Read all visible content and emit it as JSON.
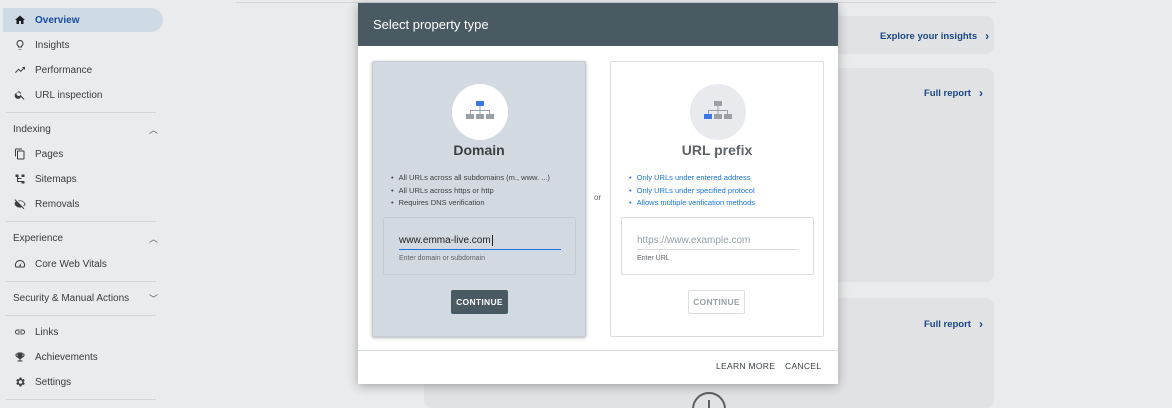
{
  "sidebar": {
    "top_items": [
      {
        "label": "Overview",
        "icon": "home-icon"
      },
      {
        "label": "Insights",
        "icon": "lightbulb-icon"
      },
      {
        "label": "Performance",
        "icon": "trending-up-icon"
      },
      {
        "label": "URL inspection",
        "icon": "search-icon"
      }
    ],
    "indexing": {
      "title": "Indexing",
      "items": [
        {
          "label": "Pages",
          "icon": "pages-icon"
        },
        {
          "label": "Sitemaps",
          "icon": "sitemap-icon"
        },
        {
          "label": "Removals",
          "icon": "eye-off-icon"
        }
      ]
    },
    "experience": {
      "title": "Experience",
      "items": [
        {
          "label": "Core Web Vitals",
          "icon": "speedometer-icon"
        }
      ]
    },
    "security": {
      "title": "Security & Manual Actions"
    },
    "bottom_items": [
      {
        "label": "Links",
        "icon": "link-icon"
      },
      {
        "label": "Achievements",
        "icon": "trophy-icon"
      },
      {
        "label": "Settings",
        "icon": "gear-icon"
      }
    ]
  },
  "background": {
    "explore_link": "Explore your insights",
    "full_report_1": "Full report",
    "full_report_2": "Full report"
  },
  "dialog": {
    "title": "Select property type",
    "or_label": "or",
    "domain": {
      "title": "Domain",
      "bullets": [
        "All URLs across all subdomains (m., www. ...)",
        "All URLs across https or http",
        "Requires DNS verification"
      ],
      "input_value": "www.emma-live.com",
      "input_help": "Enter domain or subdomain",
      "continue_label": "CONTINUE"
    },
    "url_prefix": {
      "title": "URL prefix",
      "bullets": [
        "Only URLs under entered address",
        "Only URLs under specified protocol",
        "Allows multiple verification methods"
      ],
      "input_placeholder": "https://www.example.com",
      "input_help": "Enter URL",
      "continue_label": "CONTINUE"
    },
    "learn_more_label": "LEARN MORE",
    "cancel_label": "CANCEL"
  },
  "colors": {
    "active_nav_bg": "#d6e2ef",
    "dialog_header": "#4a5a62",
    "link_blue": "#1a4a8a",
    "bullet_blue": "#1a73e8"
  }
}
